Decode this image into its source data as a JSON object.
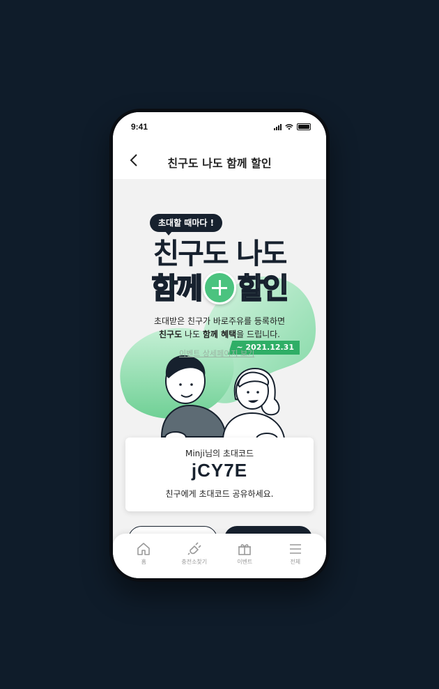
{
  "status": {
    "time": "9:41"
  },
  "header": {
    "title": "친구도 나도 함께 할인",
    "back_icon": "chevron-left-icon"
  },
  "hero": {
    "badge": "초대할 때마다 !",
    "headline_line1": "친구도 나도",
    "headline_line2_left": "함께",
    "headline_line2_right": "할인",
    "desc_line1": "초대받은 친구가 바로주유를 등록하면",
    "desc_line2_bold1": "친구도",
    "desc_line2_mid": " 나도 ",
    "desc_line2_bold2": "함께 혜택",
    "desc_line2_end": "을 드립니다.",
    "date": "~ 2021.12.31",
    "detail_link": "이벤트 상세페이지 보기"
  },
  "invite_card": {
    "owner_name": "Minji",
    "owner_suffix": "님의 초대코드",
    "code": "jCY7E",
    "hint": "친구에게 초대코드 공유하세요."
  },
  "tabbar": {
    "items": [
      {
        "label": "홈",
        "icon": "home-icon"
      },
      {
        "label": "충전소찾기",
        "icon": "ev-plug-icon"
      },
      {
        "label": "이벤트",
        "icon": "gift-icon"
      },
      {
        "label": "전체",
        "icon": "menu-icon"
      }
    ]
  },
  "colors": {
    "brand_dark": "#17212e",
    "accent_green": "#36b46f",
    "background": "#0f1c2a"
  }
}
